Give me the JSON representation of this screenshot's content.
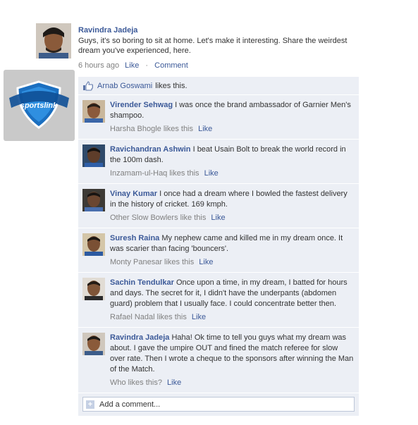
{
  "post": {
    "author": "Ravindra Jadeja",
    "text": "Guys, it's so boring to sit at home. Let's make it interesting. Share the weirdest dream you've experienced, here.",
    "time": "6 hours ago",
    "like_label": "Like",
    "comment_label": "Comment",
    "separator": "·"
  },
  "logo": {
    "text": "sportslink",
    "color": "#1b6fc0"
  },
  "likes": {
    "name": "Arnab Goswami",
    "suffix": "likes this."
  },
  "comments": [
    {
      "name": "Virender Sehwag",
      "text": "I was once the brand ambassador of Garnier Men's shampoo.",
      "likes_text": "Harsha Bhogle likes this",
      "like_label": "Like"
    },
    {
      "name": "Ravichandran Ashwin",
      "text": "I beat Usain Bolt to break the world record in the 100m dash.",
      "likes_text": "Inzamam-ul-Haq likes this",
      "like_label": "Like"
    },
    {
      "name": "Vinay Kumar",
      "text": "I once had a dream where I bowled the fastest delivery in the history of cricket.  169 kmph.",
      "likes_text": "Other Slow Bowlers like this",
      "like_label": "Like"
    },
    {
      "name": "Suresh Raina",
      "text": "My nephew came and killed me in my dream once. It was scarier than facing 'bouncers'.",
      "likes_text": "Monty Panesar likes this",
      "like_label": "Like"
    },
    {
      "name": "Sachin Tendulkar",
      "text": "Once upon a time, in my dream, I batted for hours and days. The secret for it, I didn't have the underpants (abdomen guard) problem that I usually face. I could concentrate better then.",
      "likes_text": "Rafael Nadal likes this",
      "like_label": "Like"
    },
    {
      "name": "Ravindra Jadeja",
      "text": "Haha! Ok time to tell you guys what my dream was about. I gave the umpire OUT and fined the match referee for slow over rate. Then I wrote a cheque to the sponsors after winning the Man of the Match.",
      "likes_text": "Who likes this?",
      "like_label": "Like"
    }
  ],
  "add_comment": {
    "placeholder": "Add a comment..."
  },
  "colors": {
    "link": "#3b5998",
    "panel": "#eceff5",
    "meta_grey": "#808080"
  }
}
